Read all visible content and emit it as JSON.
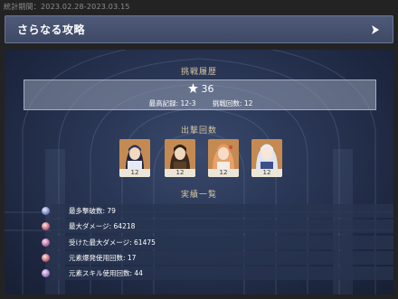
{
  "stat_period": "統計期間：2023.02.28-2023.03.15",
  "header": {
    "title": "さらなる攻略",
    "arrow_icon": "chevron-right-icon"
  },
  "challenge": {
    "heading": "挑戦履歴",
    "stars": "36",
    "best_record_label": "最高記録: 12-3",
    "attempts_label": "挑戦回数: 12"
  },
  "battle": {
    "heading": "出撃回数",
    "characters": [
      {
        "name": "yelan",
        "count": "12"
      },
      {
        "name": "zhongli",
        "count": "12"
      },
      {
        "name": "yoimiya",
        "count": "12"
      },
      {
        "name": "ayaka",
        "count": "12"
      }
    ]
  },
  "achievements": {
    "heading": "実績一覧",
    "rows": [
      {
        "label": "最多撃破数: 79",
        "icon": "defeat-icon"
      },
      {
        "label": "最大ダメージ: 64218",
        "icon": "damage-icon"
      },
      {
        "label": "受けた最大ダメージ: 61475",
        "icon": "damage-taken-icon"
      },
      {
        "label": "元素爆発使用回数: 17",
        "icon": "burst-icon"
      },
      {
        "label": "元素スキル使用回数: 44",
        "icon": "skill-icon"
      }
    ]
  },
  "colors": {
    "background": "#232324",
    "header": "#4e5a78",
    "panel": "#2b3858",
    "accent_gold": "#d8c8a0",
    "card_orange": "#c98e55"
  }
}
